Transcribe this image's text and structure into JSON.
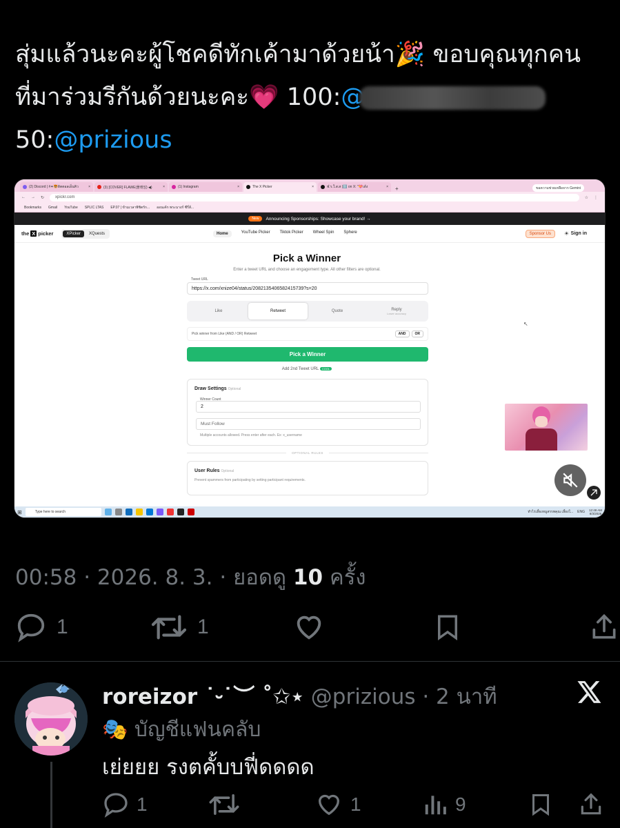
{
  "tweet": {
    "text_part1": "สุ่มแล้วนะคะผู้โชคดีทักเค้ามาด้วยน้า",
    "emoji_party": "🎉",
    "text_part2": " ขอบคุณทุกคนที่มาร่วมรีกันด้วยนะคะ",
    "emoji_heart": "💗",
    "text_part3": " 100:",
    "mention1_visible": "@",
    "text_part4": "50:",
    "mention2": "@prizious"
  },
  "screenshot": {
    "tabs": [
      {
        "label": "(2) Discord | #✦🐯ดิตตอลเอ็นคิว",
        "close": "×"
      },
      {
        "label": "(3) [COVER] FLAWE(플래잉) ◀)",
        "close": "×"
      },
      {
        "label": "(1) Instagram",
        "close": "×"
      },
      {
        "label": "The X Picker",
        "close": "×"
      },
      {
        "label": "ฬ.ร.ใ.ส.ส (ℹ️ on X: \"💝เด้ง",
        "close": "×"
      }
    ],
    "new_tab": "+",
    "gemini_label": "ขอความช่วยเหลือจาก Gemini",
    "url": "xpickr.com",
    "bookmarks": [
      "Bookmarks",
      "Gmail",
      "YouTube",
      "SPLIC LTAS",
      "EP.07 | ข้ามเวลาพิชิตรัก...",
      "ออนเค้ก พระนางก์ ซีรี่ส์..."
    ],
    "announce_badge": "New",
    "announce_text": "Announcing Sponsorships: Showcase your brand! →",
    "site": {
      "logo_the": "the",
      "logo_x": "X",
      "logo_picker": "picker",
      "toggle": [
        "XPicker",
        "XQuests"
      ],
      "nav": [
        "Home",
        "YouTube Picker",
        "Tiktok Picker",
        "Wheel Spin",
        "Sphere"
      ],
      "sponsor": "Sponsor Us",
      "theme_icon": "☀",
      "signin": "Sign in"
    },
    "picker": {
      "title": "Pick a Winner",
      "subtitle": "Enter a tweet URL and choose an engagement type. All other filters are optional.",
      "url_label": "Tweet URL",
      "url_value": "https://x.com/xnize04/status/2082135406582415739?s=20",
      "engagements": [
        "Like",
        "Retweet",
        "Quote",
        "Reply"
      ],
      "reply_note": "Lower accuracy",
      "andor_text": "Pick winner from Like (AND / OR) Retweet",
      "and": "AND",
      "or": "OR",
      "pick_button": "Pick a Winner",
      "add_second": "Add 2nd Tweet URL",
      "cool": "COOL",
      "draw_title": "Draw Settings",
      "optional": "Optional",
      "winner_count_label": "Winner Count",
      "winner_count": "2",
      "must_follow": "Must Follow",
      "hint": "Multiple accounts allowed. Press enter after each. Ex: x_username",
      "optional_rules": "OPTIONAL RULES",
      "user_rules": "User Rules",
      "user_rules_hint": "Prevent spammers from participating by setting participant requirements."
    },
    "taskbar": {
      "search": "Type here to search",
      "notif": "ทำไร่เลี้ยงหมูสรรพคุณ เลี้ยงใ...",
      "lang": "ENG",
      "time": "12:48 AM",
      "date": "8/3/2026"
    }
  },
  "meta": {
    "time": "00:58 · 2026. 8. 3. · ยอดดู ",
    "views": "10",
    "views_suffix": " ครั้ง"
  },
  "actions": {
    "replies": "1",
    "retweets": "1"
  },
  "reply": {
    "name": "roreizor ˙⏑˙︶ ˚✩⋆",
    "handle": " @prizious · 2 นาที",
    "fan_emoji": "🎭",
    "fan_label": " บัญชีแฟนคลับ",
    "text": "เย่ยยย รงตคั้บบฟี่ดดดด",
    "replies": "1",
    "likes": "1",
    "views": "9"
  },
  "colors": {
    "link": "#1d9bf0",
    "muted": "#71767b",
    "text": "#e7e9ea",
    "pick_green": "#1fb86e"
  }
}
